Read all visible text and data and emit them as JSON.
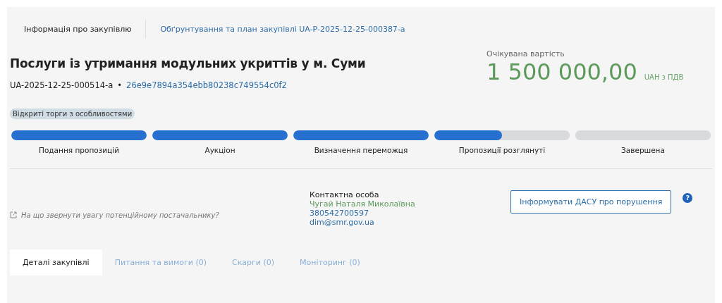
{
  "top_nav": [
    {
      "label": "Інформація про закупівлю",
      "selected": true
    },
    {
      "label": "Обґрунтування та план закупівлі UA-P-2025-12-25-000387-a",
      "selected": false
    }
  ],
  "title": "Послуги із утримання модульних укриттів у м. Суми",
  "tender_id": "UA-2025-12-25-000514-a",
  "separator": "•",
  "hash": "26e9e7894a354ebb80238c749554c0f2",
  "badge": "Відкриті торги з особливостями",
  "value": {
    "label": "Очікувана вартість",
    "amount": "1 500 000,00",
    "currency": "UAH з ПДВ"
  },
  "stages": [
    {
      "label": "Подання пропозицій",
      "level": 1
    },
    {
      "label": "Аукціон",
      "level": 1
    },
    {
      "label": "Визначення переможця",
      "level": 1
    },
    {
      "label": "Пропозиції розглянуті",
      "level": 0.5
    },
    {
      "label": "Завершена",
      "level": 0
    }
  ],
  "hint_link": "На що звернути увагу потенційному постачальнику?",
  "contact": {
    "heading": "Контактна особа",
    "name": "Чугай Наталя Миколаївна",
    "phone": "380542700597",
    "email": "dim@smr.gov.ua"
  },
  "report_button": "Інформувати ДАСУ про порушення",
  "help": "?",
  "tabs": [
    {
      "label": "Деталі закупівлі",
      "selected": true
    },
    {
      "label": "Питання та вимоги (0)",
      "selected": false
    },
    {
      "label": "Скарги (0)",
      "selected": false
    },
    {
      "label": "Моніторинг (0)",
      "selected": false
    }
  ]
}
